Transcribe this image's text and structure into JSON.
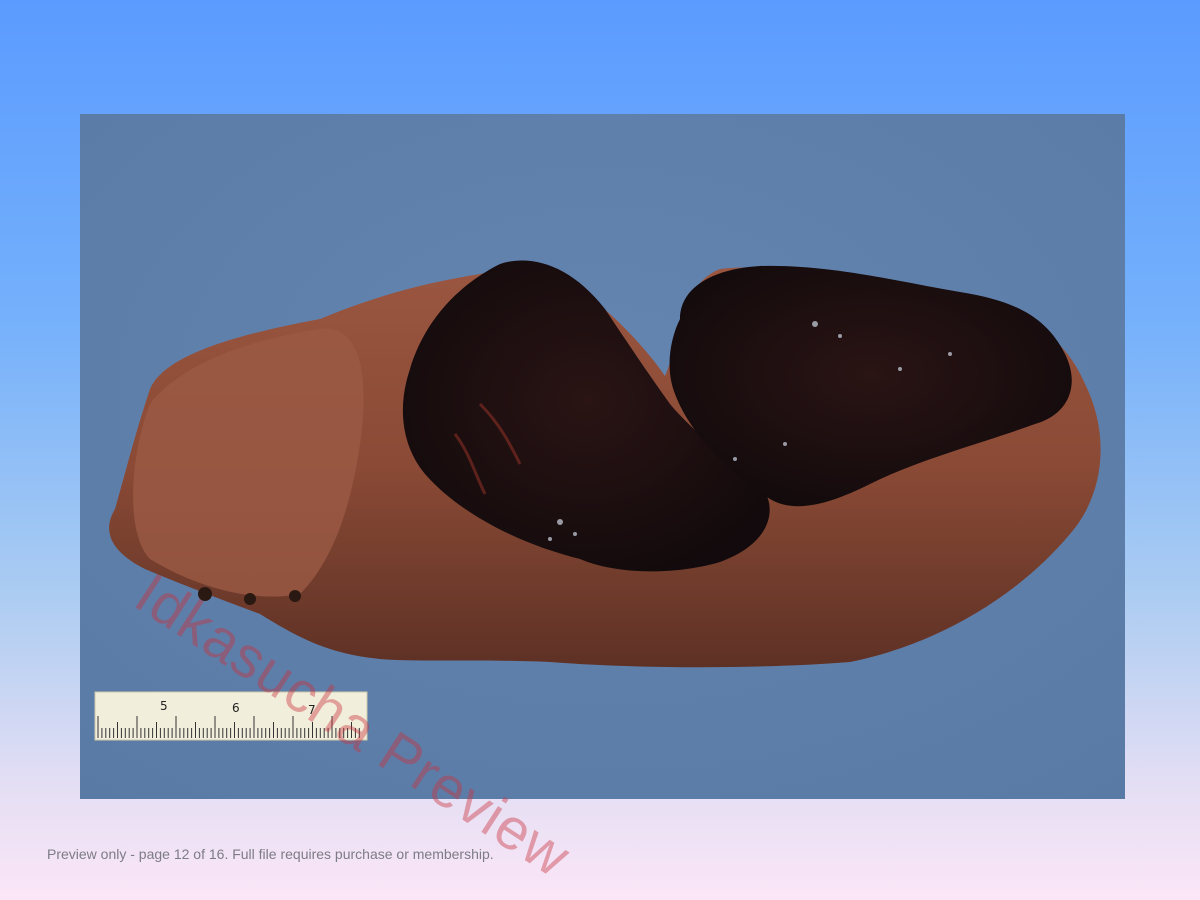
{
  "watermark": "Idkasucha Preview",
  "ruler": {
    "labels": [
      "5",
      "6",
      "7"
    ]
  },
  "footer": {
    "text": "Preview only - page 12 of 16. Full file requires purchase or membership."
  },
  "colors": {
    "page_top": "#5b9bff",
    "page_bottom": "#fbe6f7",
    "photo_backdrop": "#5f81ae",
    "tissue": "#8a4a35",
    "clot": "#1a0f10",
    "watermark": "#c8323c"
  }
}
